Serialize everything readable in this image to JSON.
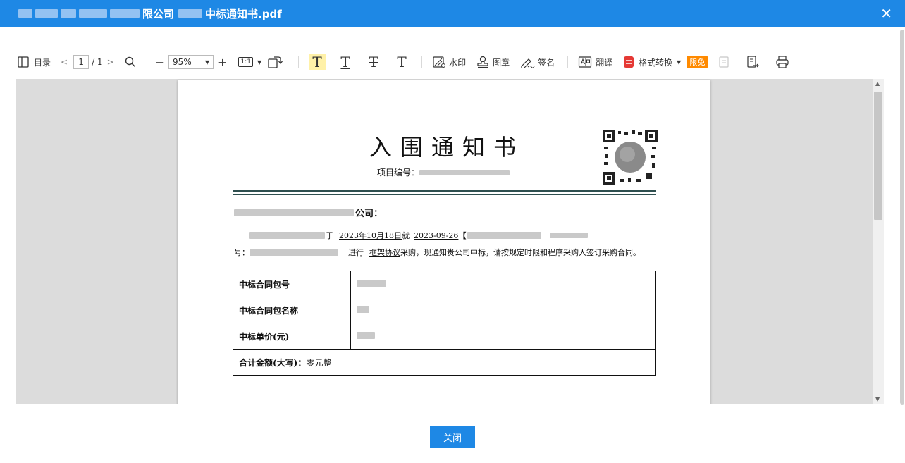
{
  "window": {
    "title_visible": "限公司 中标通知书.pdf",
    "title_prefix": "限公司",
    "title_suffix": "中标通知书.pdf",
    "close_glyph": "✕"
  },
  "toolbar": {
    "toc_label": "目录",
    "page_current": "1",
    "page_total": "/ 1",
    "zoom_value": "95%",
    "actual_size_label": "1:1",
    "watermark_label": "水印",
    "seal_label": "图章",
    "signature_label": "签名",
    "translate_label": "翻译",
    "format_convert_label": "格式转换",
    "free_badge": "限免"
  },
  "document": {
    "title": "入围通知书",
    "project_no_label": "项目编号：",
    "addressee_suffix": "公司：",
    "para1_text_a": "于",
    "para1_date": "2023年10月18日",
    "para1_text_b": "就",
    "para1_date2": "2023-09-26",
    "para1_bracket": "【",
    "para2_prefix": "号：",
    "para2_text_a": "进行",
    "para2_method": "框架协议",
    "para2_text_b": "采购，现通知贵公司中标，请按规定时限和程序采购人签订采购合同。",
    "table": [
      {
        "label": "中标合同包号"
      },
      {
        "label": "中标合同包名称"
      },
      {
        "label": "中标单价(元)"
      }
    ],
    "total_label": "合计金额(大写)：",
    "total_value": "零元整"
  },
  "footer": {
    "close_label": "关闭"
  },
  "colors": {
    "titlebar": "#1e88e5",
    "button": "#1e88e5",
    "badge": "#ff8a00",
    "highlight": "#fff1a8"
  }
}
